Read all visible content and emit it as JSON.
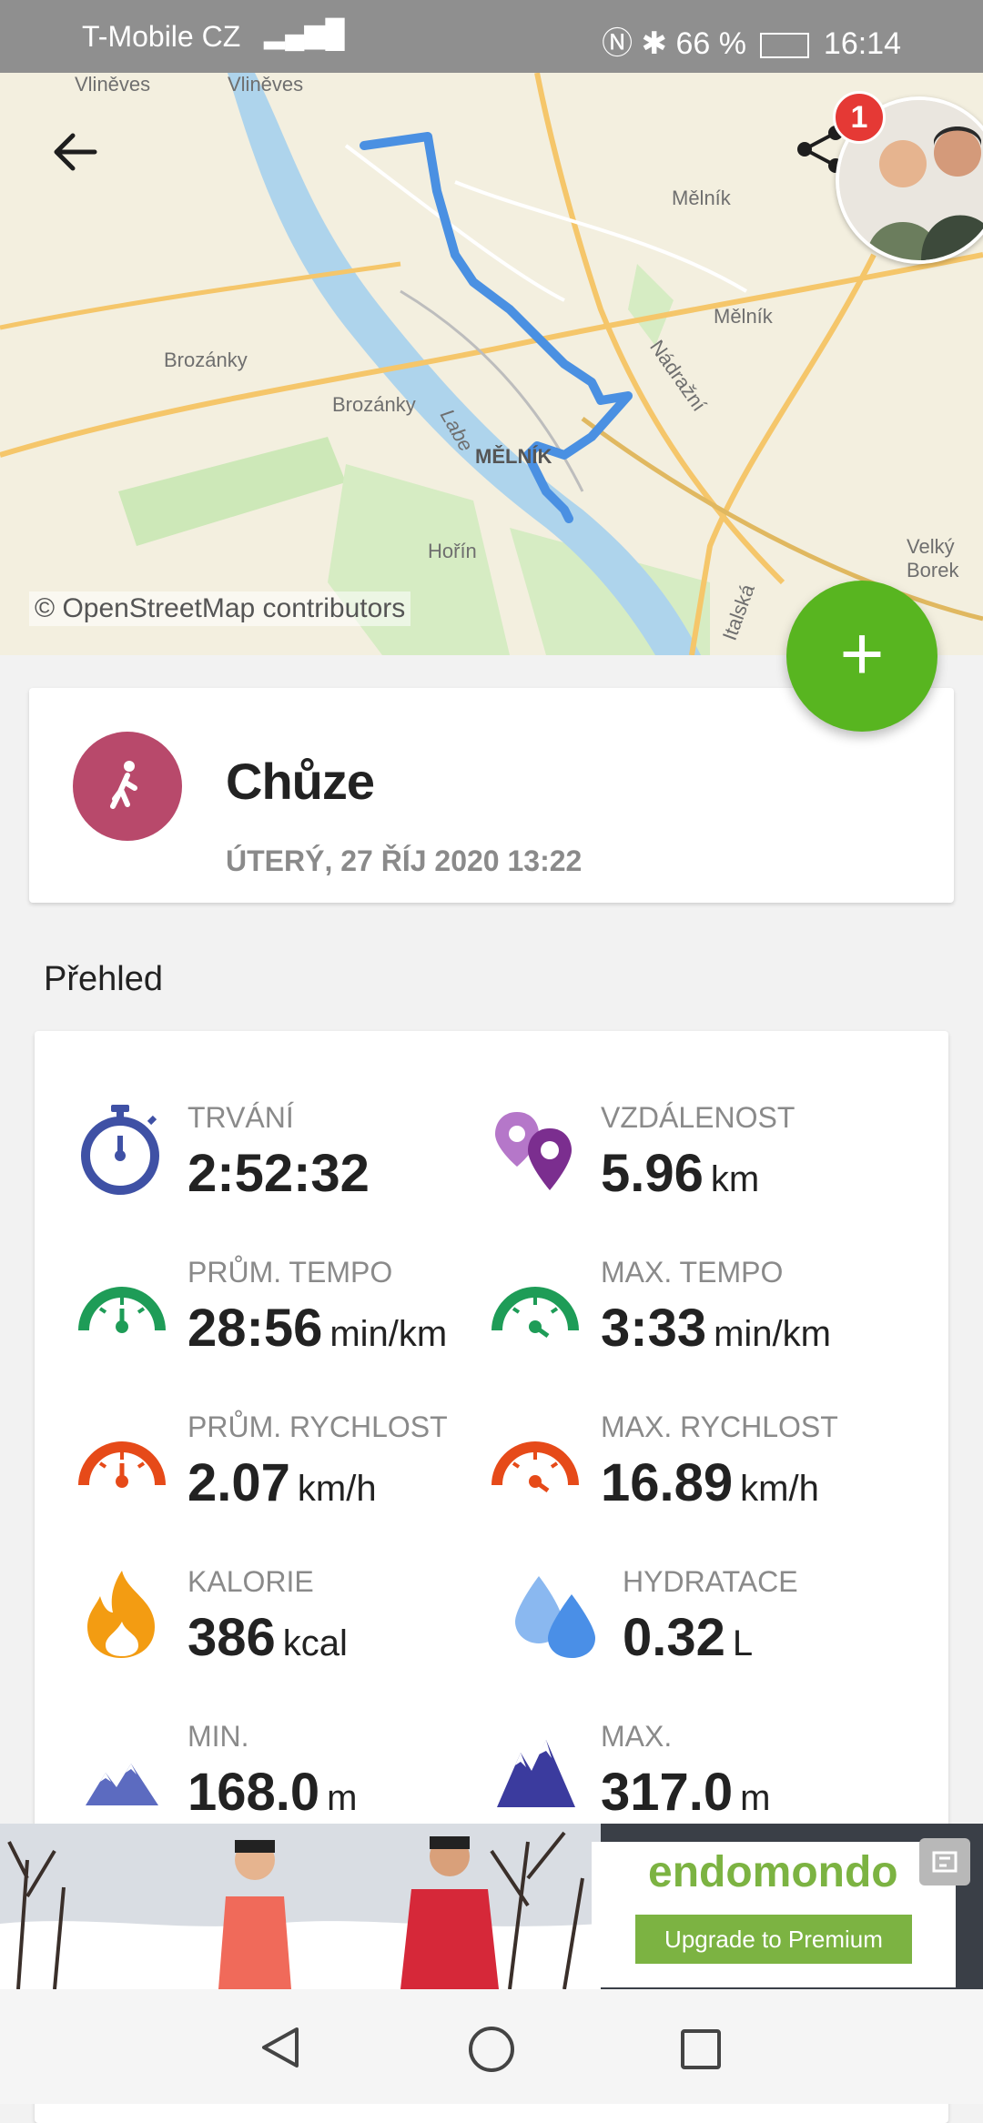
{
  "status_bar": {
    "carrier": "T-Mobile CZ",
    "battery": "66 %",
    "time": "16:14"
  },
  "map": {
    "attribution": "© OpenStreetMap contributors",
    "place_labels": [
      "Vliněves",
      "Vliněves",
      "Mělník",
      "Mělník",
      "Brozánky",
      "Brozánky",
      "MĚLNÍK",
      "Hořín",
      "Velký Borek",
      "Nádražní",
      "Italská",
      "Labe"
    ]
  },
  "notification_badge": "1",
  "activity": {
    "sport": "Chůze",
    "date": "ÚTERÝ, 27 ŘÍJ 2020 13:22"
  },
  "overview": {
    "title": "Přehled",
    "stats": [
      {
        "label": "TRVÁNÍ",
        "value": "2:52:32",
        "unit": "",
        "icon": "stopwatch-icon",
        "color": "#3f51a5"
      },
      {
        "label": "VZDÁLENOST",
        "value": "5.96",
        "unit": "km",
        "icon": "location-pins-icon",
        "color": "#8e44ad"
      },
      {
        "label": "PRŮM. TEMPO",
        "value": "28:56",
        "unit": "min/km",
        "icon": "gauge-icon",
        "color": "#1e9c57"
      },
      {
        "label": "MAX. TEMPO",
        "value": "3:33",
        "unit": "min/km",
        "icon": "gauge-icon",
        "color": "#1e9c57"
      },
      {
        "label": "PRŮM. RYCHLOST",
        "value": "2.07",
        "unit": "km/h",
        "icon": "gauge-icon",
        "color": "#e64a19"
      },
      {
        "label": "MAX. RYCHLOST",
        "value": "16.89",
        "unit": "km/h",
        "icon": "gauge-icon",
        "color": "#e64a19"
      },
      {
        "label": "KALORIE",
        "value": "386",
        "unit": "kcal",
        "icon": "flame-icon",
        "color": "#f39c12"
      },
      {
        "label": "HYDRATACE",
        "value": "0.32",
        "unit": "L",
        "icon": "water-drops-icon",
        "color": "#4a8fe7"
      },
      {
        "label": "MIN.",
        "value": "168.0",
        "unit": "m",
        "icon": "mountain-icon",
        "color": "#5c6bc0"
      },
      {
        "label": "MAX.",
        "value": "317.0",
        "unit": "m",
        "icon": "mountain-icon",
        "color": "#3b3b9e"
      }
    ]
  },
  "ad": {
    "brand": "endomondo",
    "button": "Upgrade to Premium"
  },
  "colors": {
    "accent_green": "#58b520",
    "sport_color": "#b8496b",
    "route_blue": "#4a90e2"
  }
}
